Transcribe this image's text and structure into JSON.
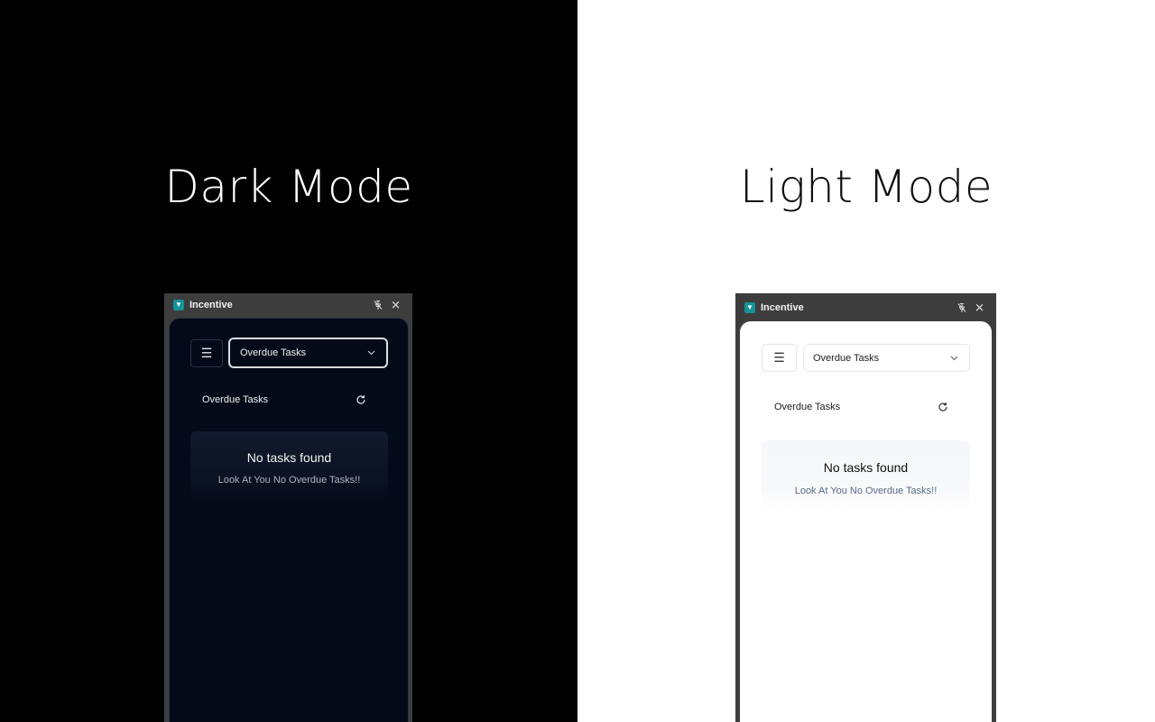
{
  "dark": {
    "heading": "Dark Mode",
    "window": {
      "app_title": "Incentive",
      "filter_selected": "Overdue Tasks",
      "section_title": "Overdue Tasks",
      "empty_title": "No tasks found",
      "empty_message": "Look At You No Overdue Tasks!!"
    }
  },
  "light": {
    "heading": "Light Mode",
    "window": {
      "app_title": "Incentive",
      "filter_selected": "Overdue Tasks",
      "section_title": "Overdue Tasks",
      "empty_title": "No tasks found",
      "empty_message": "Look At You No Overdue Tasks!!"
    }
  },
  "icons": {
    "app_logo": "trophy-icon",
    "pin": "pin-off-icon",
    "close": "close-icon",
    "menu": "hamburger-menu-icon",
    "dropdown": "chevron-down-icon",
    "refresh": "refresh-icon"
  },
  "colors": {
    "accent_logo": "#14939a",
    "dark_panel": "#050a18",
    "dark_titlebar": "#3d3d3d",
    "light_panel": "#ffffff"
  }
}
